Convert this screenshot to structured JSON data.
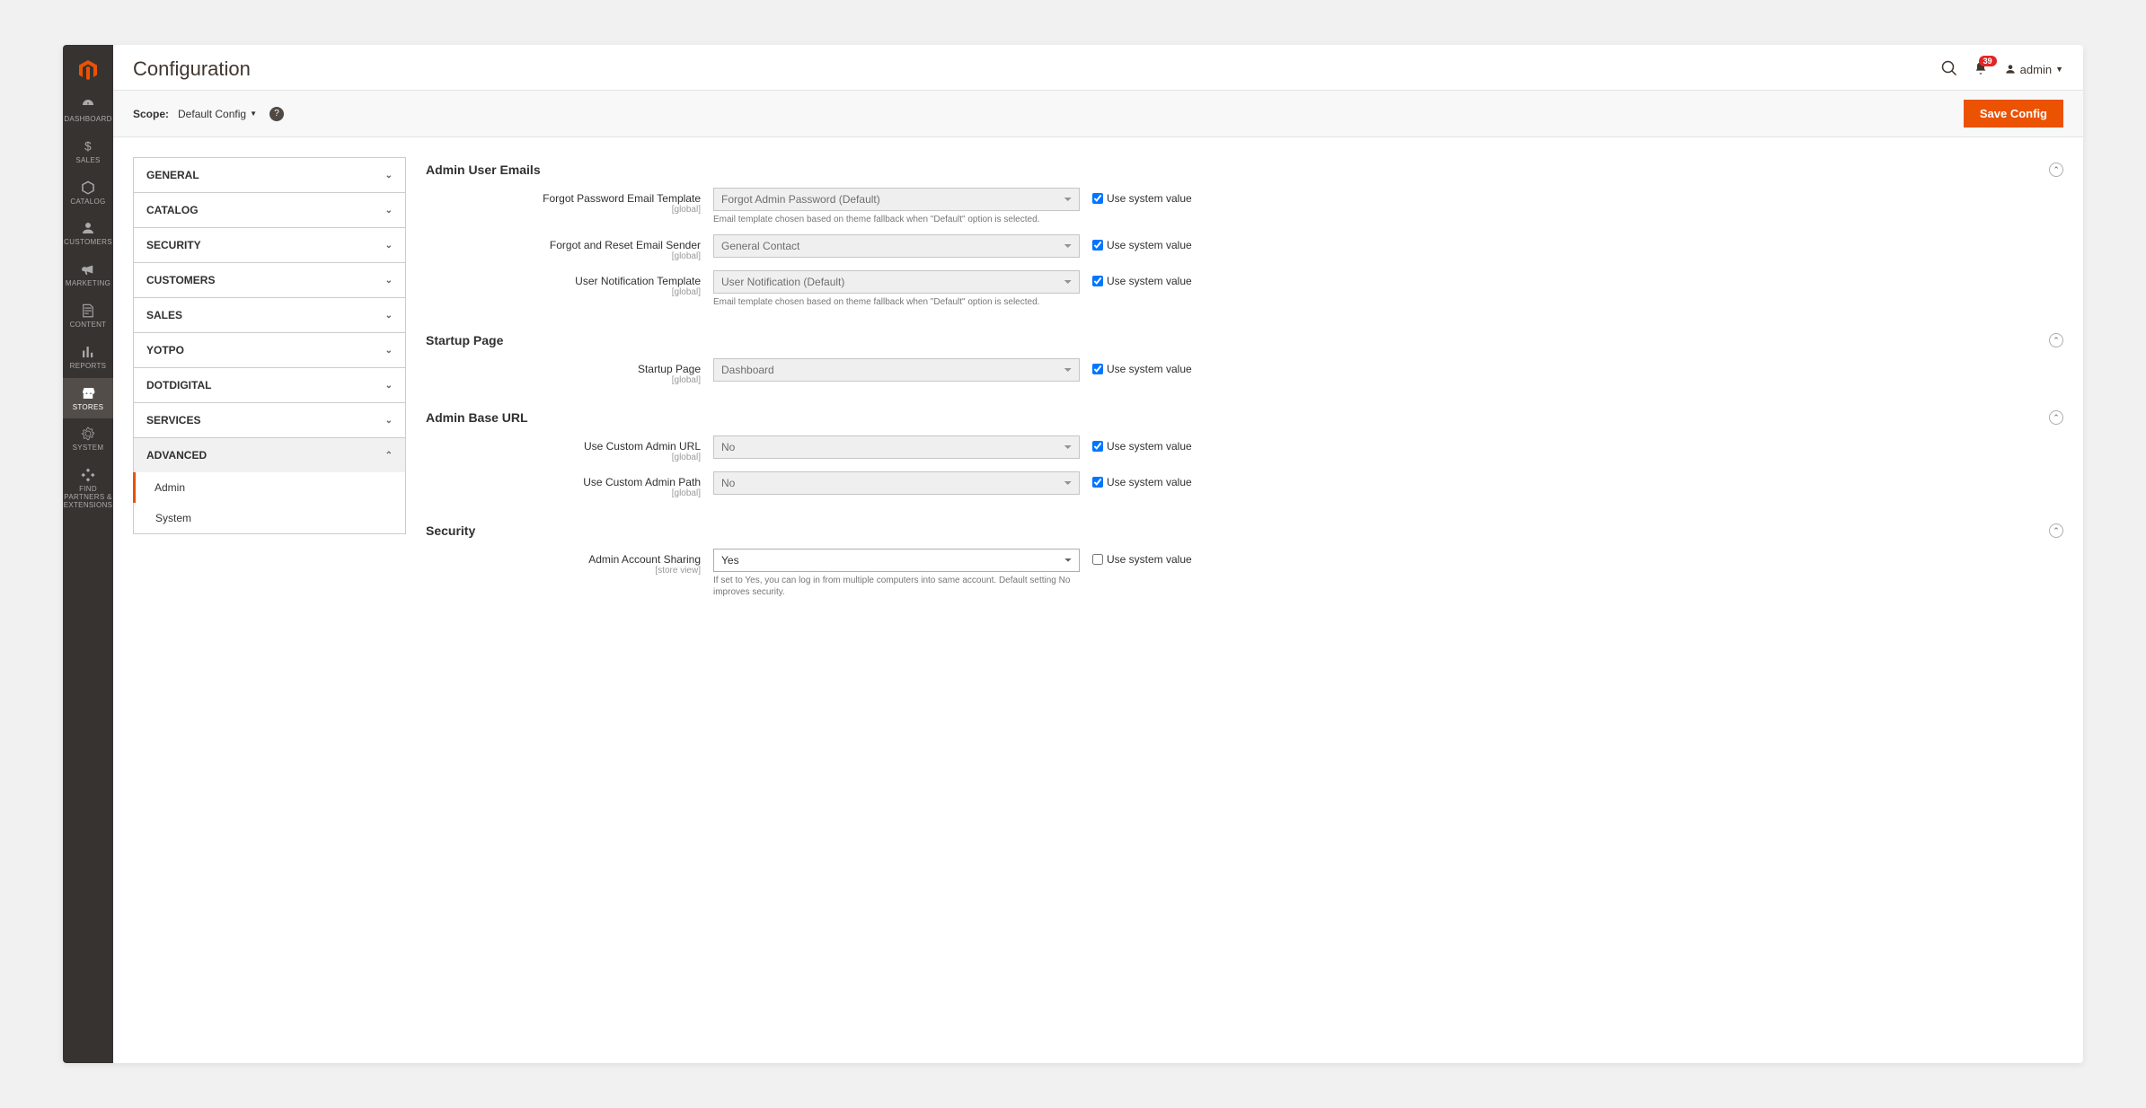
{
  "header": {
    "title": "Configuration",
    "notification_count": "39",
    "admin_user": "admin"
  },
  "scopebar": {
    "label": "Scope:",
    "value": "Default Config",
    "save_button": "Save Config"
  },
  "sidenav": [
    {
      "label": "DASHBOARD"
    },
    {
      "label": "SALES"
    },
    {
      "label": "CATALOG"
    },
    {
      "label": "CUSTOMERS"
    },
    {
      "label": "MARKETING"
    },
    {
      "label": "CONTENT"
    },
    {
      "label": "REPORTS"
    },
    {
      "label": "STORES"
    },
    {
      "label": "SYSTEM"
    },
    {
      "label": "FIND PARTNERS & EXTENSIONS"
    }
  ],
  "tabs": [
    {
      "label": "GENERAL"
    },
    {
      "label": "CATALOG"
    },
    {
      "label": "SECURITY"
    },
    {
      "label": "CUSTOMERS"
    },
    {
      "label": "SALES"
    },
    {
      "label": "YOTPO"
    },
    {
      "label": "DOTDIGITAL"
    },
    {
      "label": "SERVICES"
    },
    {
      "label": "ADVANCED"
    }
  ],
  "subtabs": [
    {
      "label": "Admin"
    },
    {
      "label": "System"
    }
  ],
  "sections": {
    "emails": {
      "title": "Admin User Emails",
      "fields": {
        "forgot_template": {
          "label": "Forgot Password Email Template",
          "scope": "[global]",
          "value": "Forgot Admin Password (Default)",
          "note": "Email template chosen based on theme fallback when \"Default\" option is selected.",
          "sys": "Use system value"
        },
        "reset_sender": {
          "label": "Forgot and Reset Email Sender",
          "scope": "[global]",
          "value": "General Contact",
          "sys": "Use system value"
        },
        "user_notif": {
          "label": "User Notification Template",
          "scope": "[global]",
          "value": "User Notification (Default)",
          "note": "Email template chosen based on theme fallback when \"Default\" option is selected.",
          "sys": "Use system value"
        }
      }
    },
    "startup": {
      "title": "Startup Page",
      "fields": {
        "page": {
          "label": "Startup Page",
          "scope": "[global]",
          "value": "Dashboard",
          "sys": "Use system value"
        }
      }
    },
    "baseurl": {
      "title": "Admin Base URL",
      "fields": {
        "custom_url": {
          "label": "Use Custom Admin URL",
          "scope": "[global]",
          "value": "No",
          "sys": "Use system value"
        },
        "custom_path": {
          "label": "Use Custom Admin Path",
          "scope": "[global]",
          "value": "No",
          "sys": "Use system value"
        }
      }
    },
    "security": {
      "title": "Security",
      "fields": {
        "account_sharing": {
          "label": "Admin Account Sharing",
          "scope": "[store view]",
          "value": "Yes",
          "note": "If set to Yes, you can log in from multiple computers into same account. Default setting No improves security.",
          "sys": "Use system value"
        }
      }
    }
  }
}
